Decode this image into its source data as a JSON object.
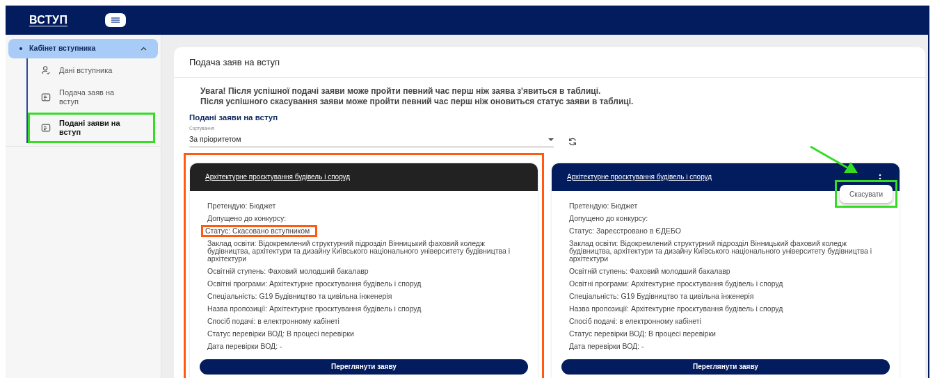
{
  "header": {
    "logo": "ВСТУП"
  },
  "sidebar": {
    "section": {
      "label": "Кабінет вступника",
      "expanded": true
    },
    "items": [
      {
        "label": "Дані вступника",
        "kind": "person",
        "selected": false,
        "highlighted": false
      },
      {
        "label": "Подача заяв на вступ",
        "kind": "form",
        "selected": false,
        "highlighted": false
      },
      {
        "label": "Подані заяви на вступ",
        "kind": "form",
        "selected": true,
        "highlighted": true
      }
    ]
  },
  "page": {
    "title": "Подача заяв на вступ",
    "notice": [
      "Увага! Після успішної подачі заяви може пройти певний час перш ніж заява з'явиться в таблиці.",
      "Після успішного скасування заяви може пройти певний час перш ніж оновиться статус заяви в таблиці."
    ],
    "section_title": "Подані заяви на вступ",
    "sort": {
      "label": "Сортування",
      "value": "За пріоритетом"
    }
  },
  "applications": [
    {
      "title": "Архітектурне проєктування будівель і споруд",
      "cancelled": true,
      "highlighted": true,
      "fields": [
        {
          "text": "Претендую: Бюджет",
          "highlighted": false
        },
        {
          "text": "Допущено до конкурсу:",
          "highlighted": false
        },
        {
          "text": "Статус: Скасовано вступником",
          "highlighted": true
        },
        {
          "text": "Заклад освіти: Відокремлений структурний підрозділ Вінницький фаховий коледж будівництва, архітектури та дизайну Київського національного університету будівництва і архітектури",
          "highlighted": false
        },
        {
          "text": "Освітній ступень: Фаховий молодший бакалавр",
          "highlighted": false
        },
        {
          "text": "Освітні програми: Архітектурне проєктування будівель і споруд",
          "highlighted": false
        },
        {
          "text": "Спеціальність: G19 Будівництво та цивільна інженерія",
          "highlighted": false
        },
        {
          "text": "Назва пропозиції: Архітектурне проєктування будівель і споруд",
          "highlighted": false
        },
        {
          "text": "Спосіб подачі: в електронному кабінеті",
          "highlighted": false
        },
        {
          "text": "Статус перевірки ВОД: В процесі перевірки",
          "highlighted": false
        },
        {
          "text": "Дата перевірки ВОД: -",
          "highlighted": false
        }
      ],
      "button": "Переглянути заяву"
    },
    {
      "title": "Архітектурне проєктування будівель і споруд",
      "cancelled": false,
      "highlighted": false,
      "menu": {
        "open": true,
        "item": "Скасувати",
        "highlighted": true,
        "pointer_arrow": true
      },
      "fields": [
        {
          "text": "Претендую: Бюджет",
          "highlighted": false
        },
        {
          "text": "Допущено до конкурсу:",
          "highlighted": false
        },
        {
          "text": "Статус: Зареєстровано в ЄДЕБО",
          "highlighted": false
        },
        {
          "text": "Заклад освіти: Відокремлений структурний підрозділ Вінницький фаховий коледж будівництва, архітектури та дизайну Київського національного університету будівництва і архітектури",
          "highlighted": false
        },
        {
          "text": "Освітній ступень: Фаховий молодший бакалавр",
          "highlighted": false
        },
        {
          "text": "Освітні програми: Архітектурне проєктування будівель і споруд",
          "highlighted": false
        },
        {
          "text": "Спеціальність: G19 Будівництво та цивільна інженерія",
          "highlighted": false
        },
        {
          "text": "Назва пропозиції: Архітектурне проєктування будівель і споруд",
          "highlighted": false
        },
        {
          "text": "Спосіб подачі: в електронному кабінеті",
          "highlighted": false
        },
        {
          "text": "Статус перевірки ВОД: В процесі перевірки",
          "highlighted": false
        },
        {
          "text": "Дата перевірки ВОД: -",
          "highlighted": false
        }
      ],
      "button": "Переглянути заяву"
    }
  ]
}
